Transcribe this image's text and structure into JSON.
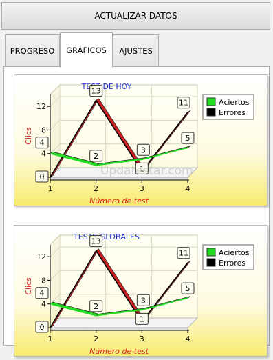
{
  "header": {
    "update_button": "ACTUALIZAR DATOS"
  },
  "tabs": [
    {
      "label": "PROGRESO",
      "active": false
    },
    {
      "label": "GRÁFICOS",
      "active": true
    },
    {
      "label": "AJUSTES",
      "active": false
    }
  ],
  "watermark": "Updatestar.com",
  "colors": {
    "aciertos": "#22dd22",
    "errores": "#000000",
    "accent_title": "#2233cc",
    "axis_title": "#dd2222"
  },
  "chart_data": [
    {
      "type": "line",
      "title": "TEST DE HOY",
      "xlabel": "Número de test",
      "ylabel": "Clics",
      "x": [
        1,
        2,
        3,
        4
      ],
      "ylim": [
        0,
        14
      ],
      "yticks": [
        "0",
        "4",
        "8",
        "12"
      ],
      "xticks": [
        "1",
        "2",
        "3",
        "4"
      ],
      "series": [
        {
          "name": "Aciertos",
          "values": [
            4,
            2,
            3,
            5
          ]
        },
        {
          "name": "Errores",
          "values": [
            0,
            13,
            1,
            11
          ]
        }
      ],
      "legend": "right"
    },
    {
      "type": "line",
      "title": "TESTS GLOBALES",
      "xlabel": "Número de test",
      "ylabel": "Clics",
      "x": [
        1,
        2,
        3,
        4
      ],
      "ylim": [
        0,
        14
      ],
      "yticks": [
        "0",
        "4",
        "8",
        "12"
      ],
      "xticks": [
        "1",
        "2",
        "3",
        "4"
      ],
      "series": [
        {
          "name": "Aciertos",
          "values": [
            4,
            2,
            3,
            5
          ]
        },
        {
          "name": "Errores",
          "values": [
            0,
            13,
            1,
            11
          ]
        }
      ],
      "legend": "right"
    }
  ]
}
